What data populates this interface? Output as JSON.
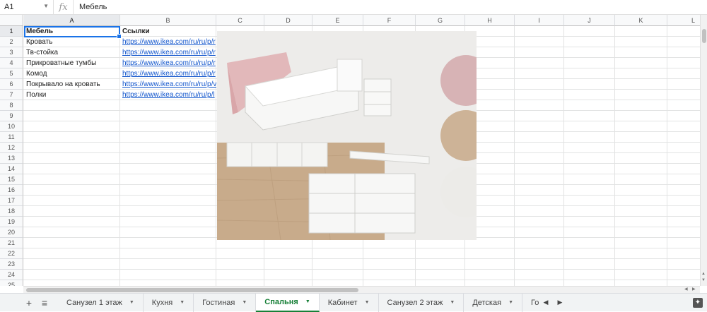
{
  "formula_bar": {
    "cell_ref": "A1",
    "fx_label": "fx",
    "value": "Мебель"
  },
  "columns": [
    "A",
    "B",
    "C",
    "D",
    "E",
    "F",
    "G",
    "H",
    "I",
    "J",
    "K",
    "L"
  ],
  "rows": [
    "1",
    "2",
    "3",
    "4",
    "5",
    "6",
    "7",
    "8",
    "9",
    "10",
    "11",
    "12",
    "13",
    "14",
    "15",
    "16",
    "17",
    "18",
    "19",
    "20",
    "21",
    "22",
    "23",
    "24",
    "25"
  ],
  "table": {
    "headers": [
      "Мебель",
      "Ссылки"
    ],
    "items": [
      {
        "name": "Кровать",
        "link": "https://www.ikea.com/ru/ru/p/r"
      },
      {
        "name": "Тв-стойка",
        "link": "https://www.ikea.com/ru/ru/p/r"
      },
      {
        "name": "Прикроватные тумбы",
        "link": "https://www.ikea.com/ru/ru/p/r"
      },
      {
        "name": "Комод",
        "link": "https://www.ikea.com/ru/ru/p/r"
      },
      {
        "name": "Покрывало на кровать",
        "link": "https://www.ikea.com/ru/ru/p/v"
      },
      {
        "name": "Полки",
        "link": "https://www.ikea.com/ru/ru/p/l"
      }
    ]
  },
  "moodboard": {
    "swatch_colors": [
      "#d7b3b5",
      "#cdb397",
      "#ecebe8"
    ],
    "floor_color": "#c9ad8e",
    "accent_pink": "#e2b8ba"
  },
  "sheet_tabs": {
    "add_icon": "+",
    "list_icon": "≡",
    "tabs": [
      {
        "label": "Санузел 1 этаж",
        "active": false
      },
      {
        "label": "Кухня",
        "active": false
      },
      {
        "label": "Гостиная",
        "active": false
      },
      {
        "label": "Спальня",
        "active": true
      },
      {
        "label": "Кабинет",
        "active": false
      },
      {
        "label": "Санузел 2 этаж",
        "active": false
      },
      {
        "label": "Детская",
        "active": false
      },
      {
        "label": "Гостевая",
        "active": false
      }
    ]
  }
}
